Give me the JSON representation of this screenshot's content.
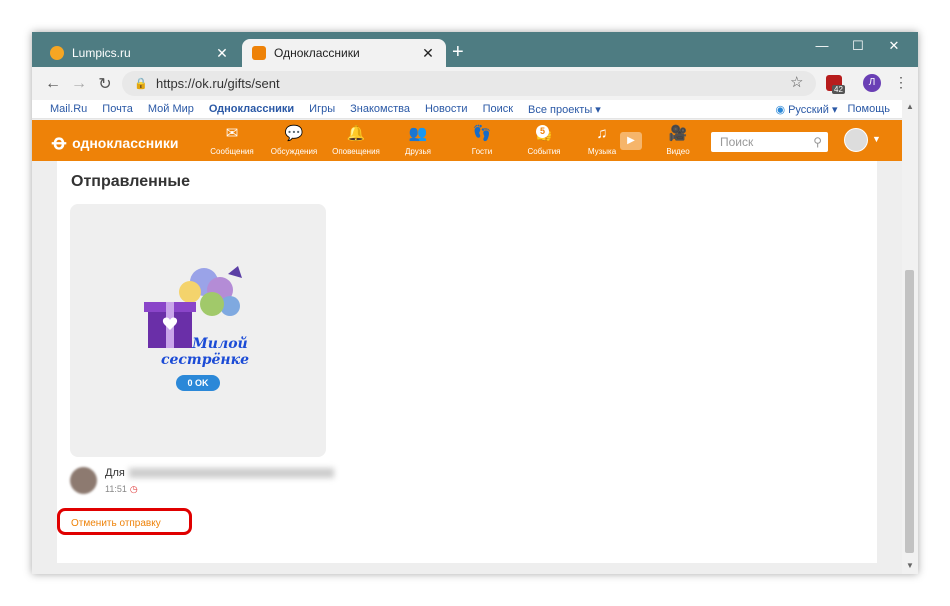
{
  "browser": {
    "tabs": [
      {
        "title": "Lumpics.ru",
        "favicon_color": "#f6a623",
        "close": "✕"
      },
      {
        "title": "Одноклассники",
        "favicon_color": "#ee8208",
        "close": "✕"
      }
    ],
    "new_tab": "+",
    "window_controls": {
      "minimize": "—",
      "maximize": "☐",
      "close": "✕"
    },
    "url": "https://ok.ru/gifts/sent",
    "extension_badge": "42",
    "profile_initial": "Л"
  },
  "portal_links": [
    "Mail.Ru",
    "Почта",
    "Мой Мир",
    "Одноклассники",
    "Игры",
    "Знакомства",
    "Новости",
    "Поиск",
    "Все проекты ▾"
  ],
  "portal_right": {
    "language": "Русский ▾",
    "help": "Помощь"
  },
  "ok_header": {
    "logo_text": "одноклассники",
    "nav": [
      {
        "label": "Сообщения",
        "icon": "envelope-icon",
        "glyph": "✉"
      },
      {
        "label": "Обсуждения",
        "icon": "chat-bubbles-icon",
        "glyph": "💬"
      },
      {
        "label": "Оповещения",
        "icon": "bell-icon",
        "glyph": "🔔"
      },
      {
        "label": "Друзья",
        "icon": "friends-icon",
        "glyph": "👥"
      },
      {
        "label": "Гости",
        "icon": "footprints-icon",
        "glyph": "👣"
      },
      {
        "label": "События",
        "icon": "events-icon",
        "glyph": "👍",
        "badge": "5"
      },
      {
        "label": "Музыка",
        "icon": "music-note-icon",
        "glyph": "♫"
      },
      {
        "label": "Видео",
        "icon": "video-camera-icon",
        "glyph": "🎥"
      }
    ],
    "search_placeholder": "Поиск"
  },
  "page": {
    "heading": "Отправленные",
    "gift": {
      "caption_line1": "Милой",
      "caption_line2": "сестрёнке",
      "ok_count": "0 OK"
    },
    "recipient_prefix": "Для",
    "time": "11:51",
    "cancel_link": "Отменить отправку"
  }
}
